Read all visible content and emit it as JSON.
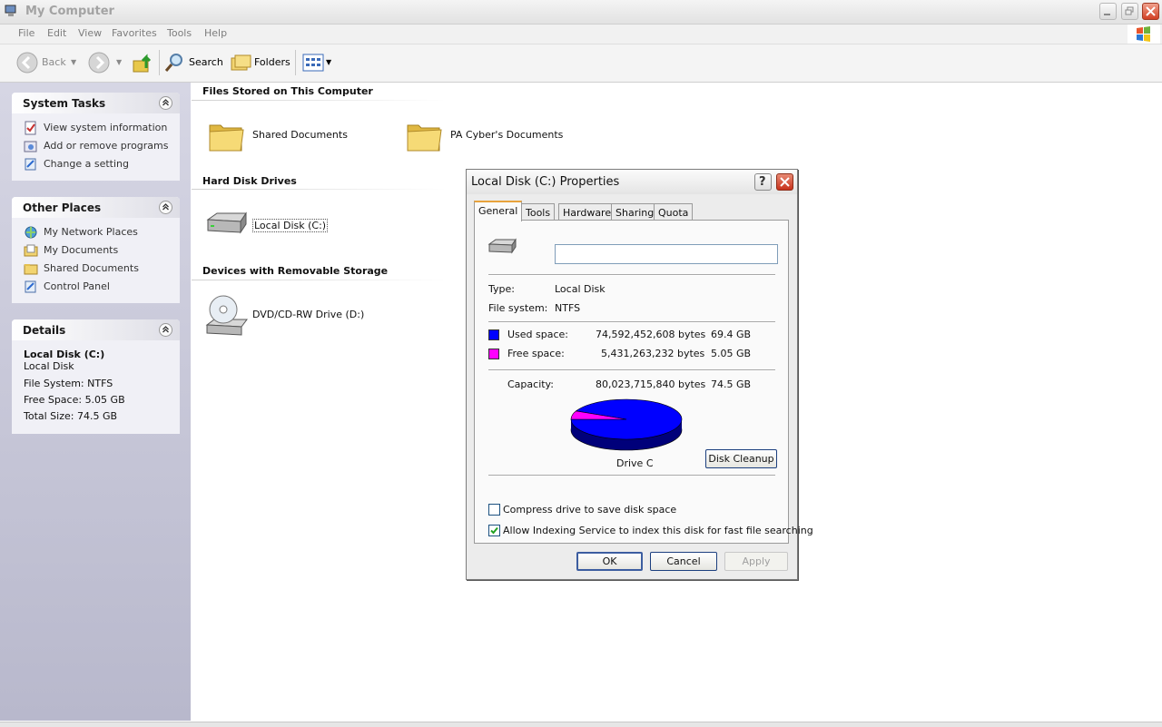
{
  "window": {
    "title": "My Computer"
  },
  "menu": [
    "File",
    "Edit",
    "View",
    "Favorites",
    "Tools",
    "Help"
  ],
  "toolbar": {
    "back_label": "Back",
    "search_label": "Search",
    "folders_label": "Folders"
  },
  "left_panel": {
    "system_tasks": {
      "title": "System Tasks",
      "items": [
        "View system information",
        "Add or remove programs",
        "Change a setting"
      ]
    },
    "other_places": {
      "title": "Other Places",
      "items": [
        "My Network Places",
        "My Documents",
        "Shared Documents",
        "Control Panel"
      ]
    },
    "details": {
      "title": "Details",
      "name": "Local Disk (C:)",
      "type": "Local Disk",
      "file_system": "File System: NTFS",
      "free_space": "Free Space: 5.05 GB",
      "total_size": "Total Size: 74.5 GB"
    }
  },
  "main": {
    "files_section": {
      "title": "Files Stored on This Computer",
      "items": [
        "Shared Documents",
        "PA Cyber's Documents"
      ]
    },
    "hdd_section": {
      "title": "Hard Disk Drives",
      "items": [
        "Local Disk (C:)"
      ]
    },
    "removable_section": {
      "title": "Devices with Removable Storage",
      "items": [
        "DVD/CD-RW Drive (D:)"
      ]
    }
  },
  "dialog": {
    "title": "Local Disk (C:) Properties",
    "tabs": [
      "General",
      "Tools",
      "Hardware",
      "Sharing",
      "Quota"
    ],
    "active_tab": "General",
    "volume_label": "",
    "type_label": "Type:",
    "type_value": "Local Disk",
    "fs_label": "File system:",
    "fs_value": "NTFS",
    "used_label": "Used space:",
    "used_bytes": "74,592,452,608 bytes",
    "used_gb": "69.4 GB",
    "free_label": "Free space:",
    "free_bytes": "5,431,263,232 bytes",
    "free_gb": "5.05 GB",
    "capacity_label": "Capacity:",
    "capacity_bytes": "80,023,715,840 bytes",
    "capacity_gb": "74.5 GB",
    "used_color": "#0000ff",
    "free_color": "#ff00ff",
    "used_fraction": 0.9321,
    "drive_label": "Drive C",
    "disk_cleanup_label": "Disk Cleanup",
    "compress_label": "Compress drive to save disk space",
    "compress_checked": false,
    "index_label": "Allow Indexing Service to index this disk for fast file searching",
    "index_checked": true,
    "ok_label": "OK",
    "cancel_label": "Cancel",
    "apply_label": "Apply"
  }
}
